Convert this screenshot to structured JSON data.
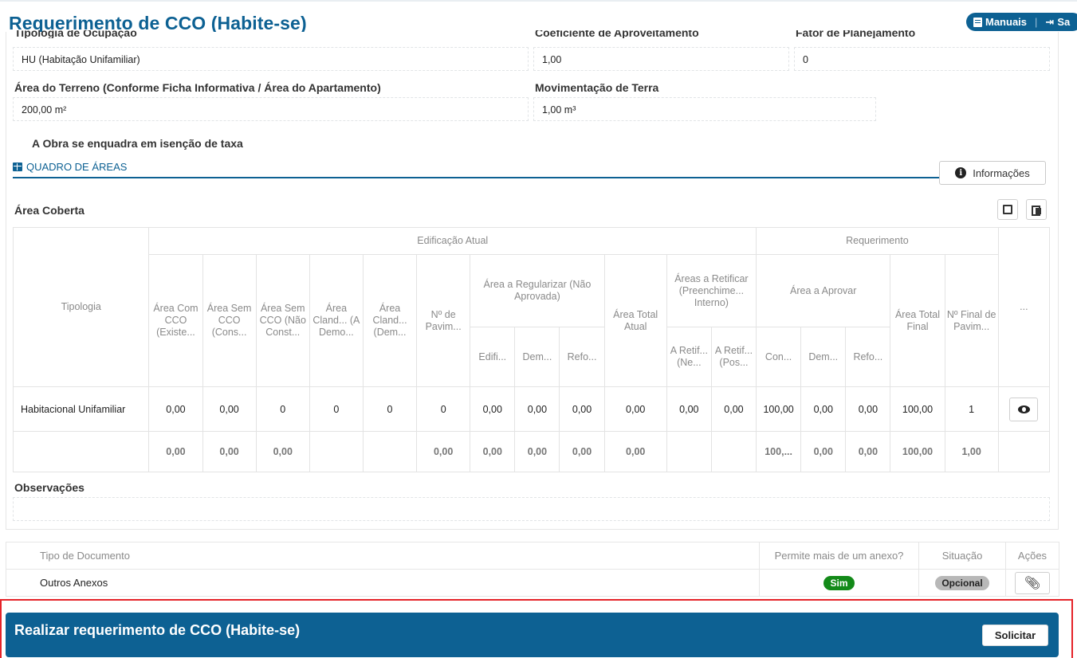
{
  "header": {
    "title": "Requerimento de CCO (Habite-se)",
    "manuals_label": "Manuais",
    "exit_label": "Sa"
  },
  "form": {
    "tipologia_label": "Tipologia de Ocupação",
    "tipologia_value": "HU (Habitação Unifamiliar)",
    "coeficiente_label": "Coeficiente de Aproveitamento",
    "coeficiente_value": "1,00",
    "fator_label": "Fator de Planejamento",
    "fator_value": "0",
    "area_terreno_label": "Área do Terreno (Conforme Ficha Informativa / Área do Apartamento)",
    "area_terreno_value": "200,00 m²",
    "movimentacao_label": "Movimentação de Terra",
    "movimentacao_value": "1,00 m³",
    "exempt_text": "A Obra se enquadra em isenção de taxa"
  },
  "quadro": {
    "section_title": "QUADRO DE ÁREAS",
    "info_button": "Informações",
    "subtitle": "Área Coberta"
  },
  "table": {
    "headers": {
      "tipologia": "Tipologia",
      "edificacao_atual": "Edificação Atual",
      "requerimento": "Requerimento",
      "area_com_cco": "Área Com CCO (Existe...",
      "area_sem_cco_cons": "Área Sem CCO (Cons...",
      "area_sem_cco_nao": "Área Sem CCO (Não Const...",
      "area_cland_a": "Área Cland... (A Demo...",
      "area_cland_dem": "Área Cland... (Dem...",
      "n_pavim": "Nº de Pavim...",
      "area_regularizar": "Área a Regularizar (Não Aprovada)",
      "area_total_atual": "Área Total Atual",
      "areas_retificar": "Áreas a Retificar (Preenchime... Interno)",
      "area_aprovar": "Área a Aprovar",
      "area_total_final": "Área Total Final",
      "n_final_pavim": "Nº Final de Pavim...",
      "more": "...",
      "edifi": "Edifi...",
      "dem": "Dem...",
      "refo": "Refo...",
      "a_retif_ne": "A Retif... (Ne...",
      "a_retif_pos": "A Retif... (Pos...",
      "con": "Con...",
      "dem2": "Dem...",
      "refo2": "Refo..."
    },
    "row": {
      "tipologia": "Habitacional Unifamiliar",
      "values": [
        "0,00",
        "0,00",
        "0",
        "0",
        "0",
        "0",
        "0,00",
        "0,00",
        "0,00",
        "0,00",
        "0,00",
        "0,00",
        "100,00",
        "0,00",
        "0,00",
        "100,00",
        "1"
      ]
    },
    "totals": {
      "values": [
        "0,00",
        "0,00",
        "0,00",
        "",
        "",
        "0,00",
        "0,00",
        "0,00",
        "0,00",
        "0,00",
        "",
        "",
        "100,...",
        "0,00",
        "0,00",
        "100,00",
        "1,00"
      ]
    }
  },
  "observations": {
    "label": "Observações"
  },
  "documents": {
    "headers": {
      "type": "Tipo de Documento",
      "multiple": "Permite mais de um anexo?",
      "status": "Situação",
      "actions": "Ações"
    },
    "rows": [
      {
        "type": "Outros Anexos",
        "multiple": "Sim",
        "status": "Opcional"
      }
    ]
  },
  "action_bar": {
    "title": "Realizar requerimento de CCO (Habite-se)",
    "submit_label": "Solicitar"
  }
}
